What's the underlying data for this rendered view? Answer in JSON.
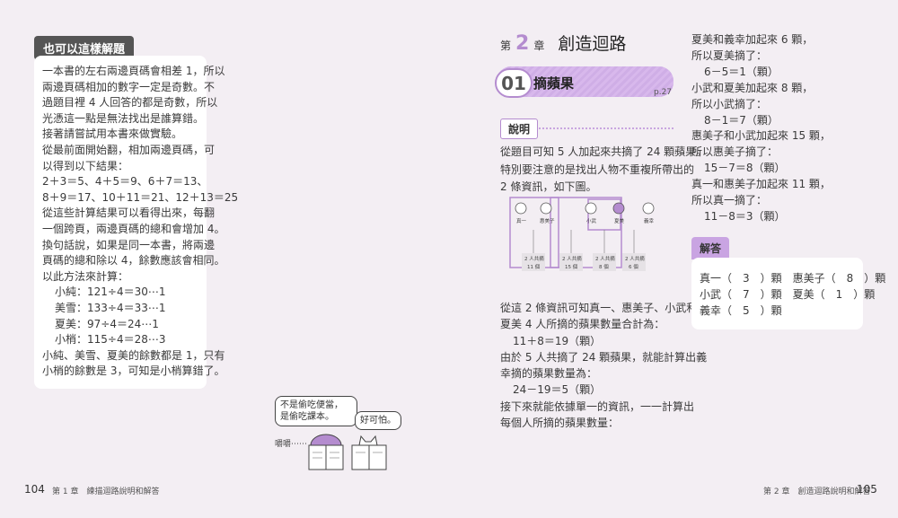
{
  "left_page": {
    "tag": "也可以這樣解題",
    "lines": [
      "一本書的左右兩邊頁碼會相差 1，所以",
      "兩邊頁碼相加的數字一定是奇數。不",
      "過題目裡 4 人回答的都是奇數，所以",
      "光憑這一點是無法找出是誰算錯。",
      "接著請嘗試用本書來做實驗。",
      "從最前面開始翻，相加兩邊頁碼，可",
      "以得到以下結果：",
      "2＋3＝5、4＋5＝9、6＋7＝13、",
      "8＋9＝17、10＋11＝21、12＋13＝25",
      "從這些計算結果可以看得出來，每翻",
      "一個跨頁，兩邊頁碼的總和會增加 4。",
      "換句話說，如果是同一本書，將兩邊",
      "頁碼的總和除以 4，餘數應該會相同。",
      "以此方法來計算：",
      "小純：121÷4＝30⋯1",
      "美雪：133÷4＝33⋯1",
      "夏美：97÷4＝24⋯1",
      "小梢：115÷4＝28⋯3",
      "小純、美雪、夏美的餘數都是 1，只有",
      "小梢的餘數是 3，可知是小梢算錯了。"
    ],
    "bubble1_line1": "不是偷吃便當，",
    "bubble1_line2": "是偷吃課本。",
    "bubble2": "好可怕。",
    "sound": "嚼嚼⋯⋯",
    "page_number": "104",
    "footer": "第 1 章　練描迴路說明和解答"
  },
  "right_page": {
    "chapter_label_pre": "第",
    "chapter_num": "2",
    "chapter_label_post": "章",
    "chapter_title": "創造迴路",
    "section_num": "01",
    "section_title": "摘蘋果",
    "section_page": "p.27",
    "explain_tag": "說明",
    "explain_lines": [
      "從題目可知 5 人加起來共摘了 24 顆蘋果。",
      "特別要注意的是找出人物不重複所帶出的",
      "2 條資訊，如下圖。"
    ],
    "diagram": {
      "names": [
        "真一",
        "惠美子",
        "小武",
        "夏美",
        "義幸"
      ],
      "box1_top": "2 人共摘",
      "box1_bottom": "11 個",
      "box2_top": "2 人共摘",
      "box2_bottom": "15 個",
      "box3_top": "2 人共摘",
      "box3_bottom": "8 個",
      "box4_top": "2 人共摘",
      "box4_bottom": "6 個"
    },
    "middle_lines": [
      "從這 2 條資訊可知真一、惠美子、小武和",
      "夏美 4 人所摘的蘋果數量合計為：",
      "11＋8＝19（顆）",
      "由於 5 人共摘了 24 顆蘋果，就能計算出義",
      "幸摘的蘋果數量為：",
      "24－19＝5（顆）",
      "接下來就能依據單一的資訊，一一計算出",
      "每個人所摘的蘋果數量："
    ],
    "right_col_lines": [
      "夏美和義幸加起來 6 顆，",
      "所以夏美摘了：",
      "6－5＝1（顆）",
      "小武和夏美加起來 8 顆，",
      "所以小武摘了：",
      "8－1＝7（顆）",
      "惠美子和小武加起來 15 顆，",
      "所以惠美子摘了：",
      "15－7＝8（顆）",
      "真一和惠美子加起來 11 顆，",
      "所以真一摘了：",
      "11－8＝3（顆）"
    ],
    "answer_tag": "解答",
    "answer_lines": [
      "真一（　3　）顆　惠美子（　8　）顆",
      "小武（　7　）顆　夏美（　1　）顆",
      "義幸（　5　）顆"
    ],
    "page_number": "105",
    "footer": "第 2 章　創造迴路說明和解答"
  },
  "colors": {
    "accent": "#b48ccf",
    "banner": "#d8b8ec",
    "answer_tag": "#c9a4e2",
    "page_bg": "#f3eef3"
  }
}
